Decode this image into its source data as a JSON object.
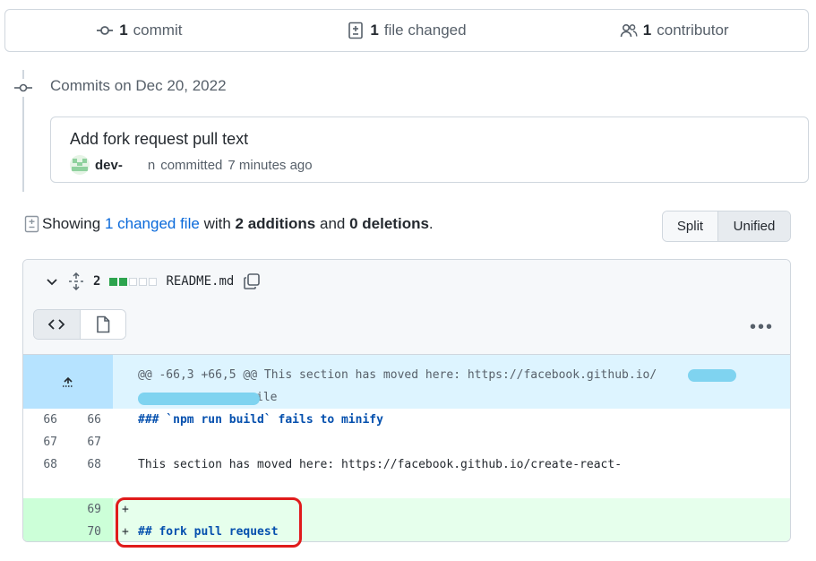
{
  "summary": {
    "commits_count": "1",
    "commits_label": "commit",
    "files_count": "1",
    "files_label": "file changed",
    "contributors_count": "1",
    "contributors_label": "contributor"
  },
  "timeline": {
    "date_heading": "Commits on Dec 20, 2022",
    "commit": {
      "title": "Add fork request pull text",
      "author": "dev-",
      "author_tail": "n",
      "action": "committed",
      "time": "7 minutes ago"
    }
  },
  "diff_summary": {
    "prefix": "Showing",
    "changed_link": "1 changed file",
    "with": "with",
    "additions": "2 additions",
    "and": "and",
    "deletions": "0 deletions",
    "suffix": ".",
    "view_split": "Split",
    "view_unified": "Unified",
    "active_view": "Unified"
  },
  "file": {
    "change_count": "2",
    "diffstat": [
      "added",
      "added",
      "neutral",
      "neutral",
      "neutral"
    ],
    "filename": "README.md",
    "hunk_header": "@@ -66,3 +66,5 @@ This section has moved here: https://facebook.github.io/",
    "hunk_tail": "ile",
    "lines": [
      {
        "old": "66",
        "new": "66",
        "sign": "",
        "type": "context",
        "text": "### `npm run build` fails to minify"
      },
      {
        "old": "67",
        "new": "67",
        "sign": "",
        "type": "context",
        "text": ""
      },
      {
        "old": "68",
        "new": "68",
        "sign": "",
        "type": "context",
        "text": "This section has moved here: https://facebook.github.io/create-react-"
      },
      {
        "old": "",
        "new": "",
        "sign": "",
        "type": "context",
        "text": ""
      },
      {
        "old": "",
        "new": "69",
        "sign": "+",
        "type": "add",
        "text": ""
      },
      {
        "old": "",
        "new": "70",
        "sign": "+",
        "type": "add",
        "text": "## fork pull request"
      }
    ]
  },
  "colors": {
    "accent_link": "#0969da",
    "addition_green": "#2da44e",
    "highlight_red": "#e01b1b"
  },
  "icons": [
    "commit-icon",
    "file-diff-icon",
    "people-icon",
    "chevron-down-icon",
    "unfold-icon",
    "copy-icon",
    "code-icon",
    "file-icon",
    "kebab-icon",
    "expand-up-icon"
  ]
}
